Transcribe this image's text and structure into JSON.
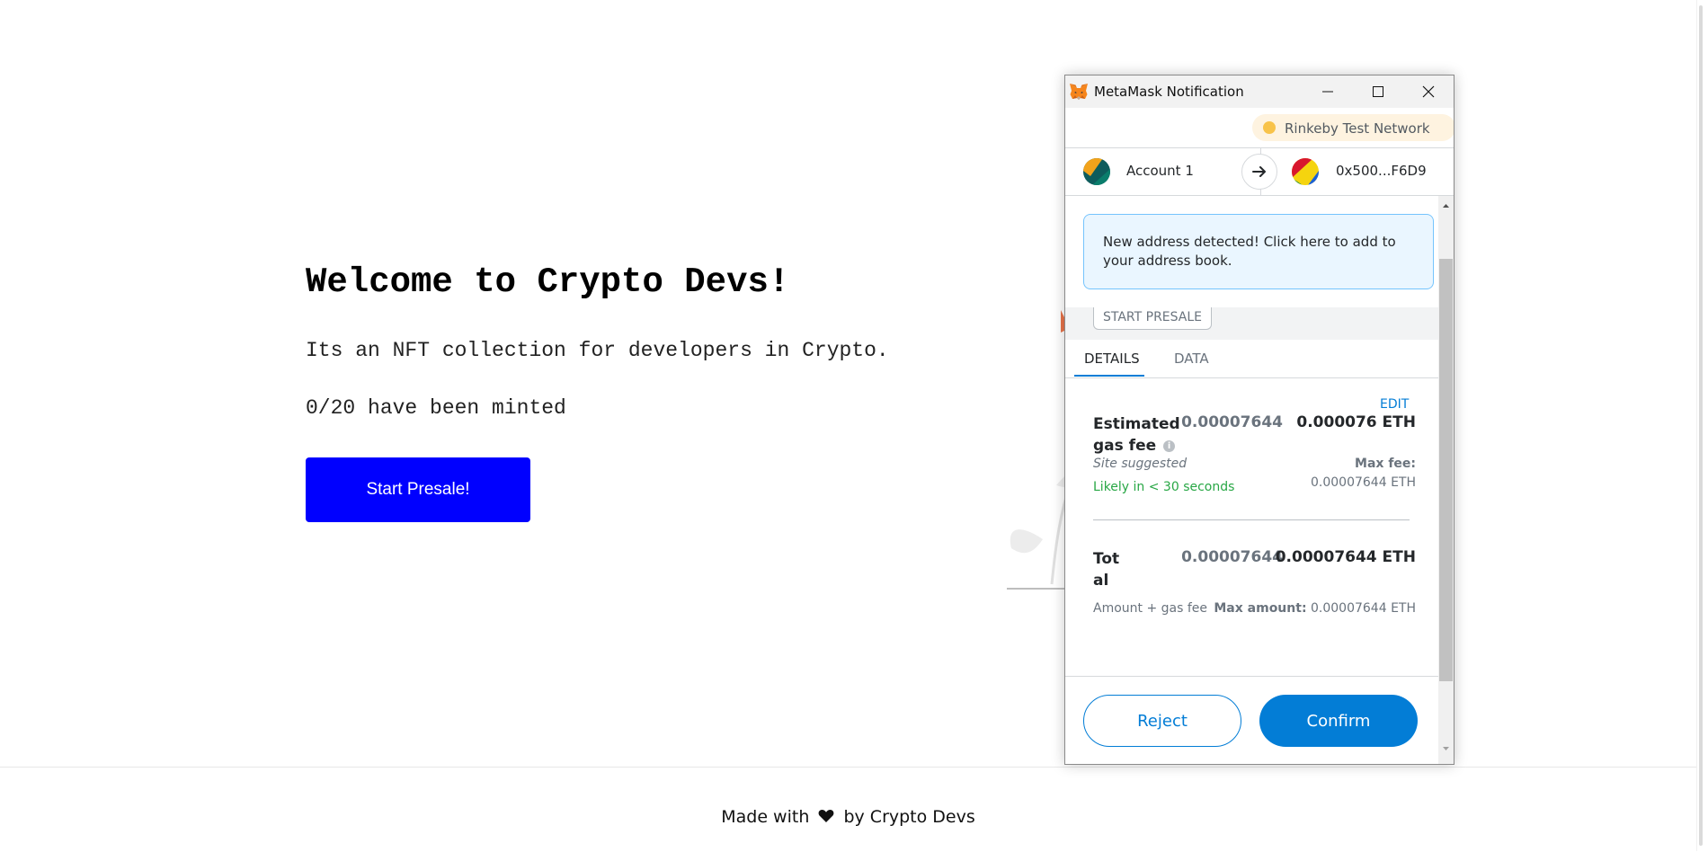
{
  "hero": {
    "title": "Welcome to Crypto Devs!",
    "description": "Its an NFT collection for developers in Crypto.",
    "minted_status": "0/20 have been minted",
    "presale_button": "Start Presale!"
  },
  "footer": {
    "made_with": "Made with",
    "by": "by Crypto Devs"
  },
  "metamask": {
    "window_title": "MetaMask Notification",
    "network": "Rinkeby Test Network",
    "from_account": "Account 1",
    "to_address": "0x500...F6D9",
    "notice": "New address detected! Click here to add to your address book.",
    "origin_method": "START PRESALE",
    "tabs": {
      "details": "DETAILS",
      "data": "DATA"
    },
    "edit_label": "EDIT",
    "estimated_fee": {
      "label": "Estimated gas fee",
      "fiat": "0.00007644",
      "eth": "0.000076 ETH",
      "site_suggested": "Site suggested",
      "likely": "Likely in < 30 seconds",
      "max_fee_label": "Max fee:",
      "max_fee_value": "0.00007644 ETH"
    },
    "total": {
      "label": "Total",
      "fiat": "0.00007644",
      "eth": "0.00007644 ETH",
      "subtitle": "Amount + gas fee",
      "max_amount_label": "Max amount:",
      "max_amount_value": "0.00007644 ETH"
    },
    "buttons": {
      "reject": "Reject",
      "confirm": "Confirm"
    }
  },
  "colors": {
    "presale_button": "#0000ff",
    "metamask_primary": "#037dd6",
    "network_dot": "#f8c34a",
    "likely_green": "#28a745"
  },
  "icons": [
    "metamask-fox-icon",
    "minimize-icon",
    "maximize-icon",
    "close-icon",
    "arrow-right-icon",
    "info-icon",
    "heart-icon"
  ]
}
